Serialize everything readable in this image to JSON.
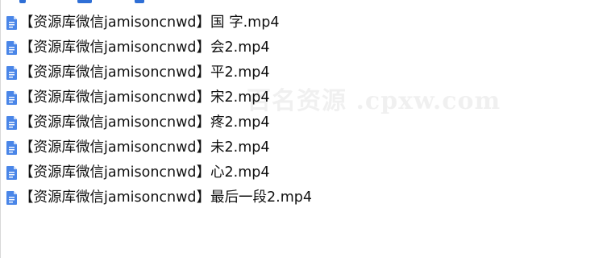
{
  "files": [
    {
      "name": "【资源库微信jamisoncnwd】国 字.mp4",
      "icon": "document-icon"
    },
    {
      "name": "【资源库微信jamisoncnwd】会2.mp4",
      "icon": "document-icon"
    },
    {
      "name": "【资源库微信jamisoncnwd】平2.mp4",
      "icon": "document-icon"
    },
    {
      "name": "【资源库微信jamisoncnwd】宋2.mp4",
      "icon": "document-icon"
    },
    {
      "name": "【资源库微信jamisoncnwd】疼2.mp4",
      "icon": "document-icon"
    },
    {
      "name": "【资源库微信jamisoncnwd】未2.mp4",
      "icon": "document-icon"
    },
    {
      "name": "【资源库微信jamisoncnwd】心2.mp4",
      "icon": "document-icon"
    },
    {
      "name": "【资源库微信jamisoncnwd】最后一段2.mp4",
      "icon": "document-icon"
    }
  ],
  "watermark": "百名资源 .cpxw.com",
  "colors": {
    "icon": "#4a86e8",
    "icon_fold": "#c7dbfa",
    "text": "#111111",
    "background": "#ffffff"
  }
}
